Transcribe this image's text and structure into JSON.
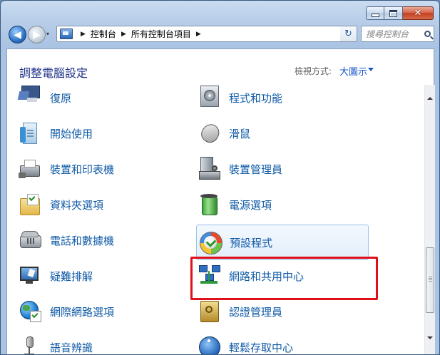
{
  "window": {
    "caption": {
      "minimize_glyph": "—",
      "maximize_glyph": "□",
      "close_glyph": "✕"
    }
  },
  "nav": {
    "back_glyph": "◀",
    "forward_glyph": "▶",
    "dropdown_glyph": "▾"
  },
  "address": {
    "crumbs": [
      "控制台",
      "所有控制台項目"
    ],
    "sep_glyph": "▶",
    "dropdown_glyph": "▾",
    "refresh_glyph": "↻"
  },
  "search": {
    "placeholder": "搜尋控制台"
  },
  "header": {
    "title": "調整電腦設定",
    "view_label": "檢視方式:",
    "view_value": "大圖示"
  },
  "items": {
    "left": [
      {
        "label": "復原",
        "icon": "recovery-icon"
      },
      {
        "label": "開始使用",
        "icon": "getting-started-icon"
      },
      {
        "label": "裝置和印表機",
        "icon": "devices-printers-icon"
      },
      {
        "label": "資料夾選項",
        "icon": "folder-options-icon"
      },
      {
        "label": "電話和數據機",
        "icon": "phone-modem-icon"
      },
      {
        "label": "疑難排解",
        "icon": "troubleshooting-icon"
      },
      {
        "label": "網際網路選項",
        "icon": "internet-options-icon"
      },
      {
        "label": "語音辨識",
        "icon": "speech-recognition-icon"
      }
    ],
    "right": [
      {
        "label": "程式和功能",
        "icon": "programs-features-icon"
      },
      {
        "label": "滑鼠",
        "icon": "mouse-icon"
      },
      {
        "label": "裝置管理員",
        "icon": "device-manager-icon"
      },
      {
        "label": "電源選項",
        "icon": "power-options-icon"
      },
      {
        "label": "預設程式",
        "icon": "default-programs-icon"
      },
      {
        "label": "網路和共用中心",
        "icon": "network-sharing-icon"
      },
      {
        "label": "認證管理員",
        "icon": "credential-manager-icon"
      },
      {
        "label": "輕鬆存取中心",
        "icon": "ease-of-access-icon"
      }
    ]
  },
  "colors": {
    "link": "#0f5aa6",
    "title": "#1e3287",
    "highlight": "#e0101a",
    "view_value": "#1a56c9"
  }
}
